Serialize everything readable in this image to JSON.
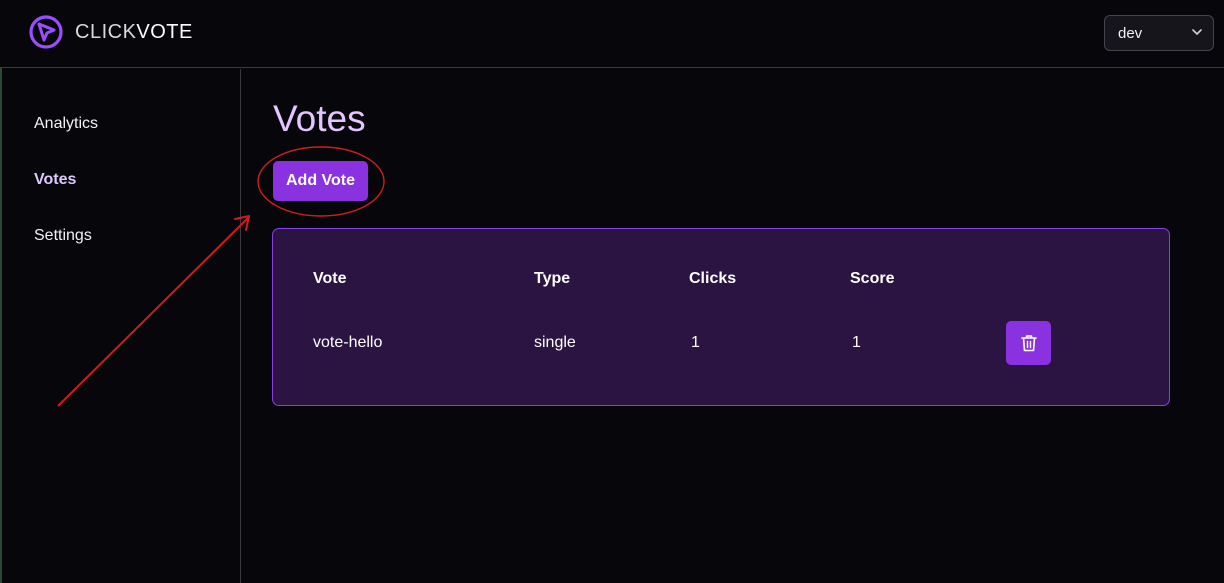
{
  "header": {
    "brand_part1": "CLICK",
    "brand_part2": "VOTE",
    "environment": {
      "selected": "dev",
      "icon": "chevron-down-icon"
    },
    "logo_icon": "cursor-circle-logo-icon"
  },
  "sidebar": {
    "items": [
      {
        "label": "Analytics",
        "active": false
      },
      {
        "label": "Votes",
        "active": true
      },
      {
        "label": "Settings",
        "active": false
      }
    ]
  },
  "main": {
    "title": "Votes",
    "add_button_label": "Add Vote",
    "table": {
      "headers": [
        "Vote",
        "Type",
        "Clicks",
        "Score"
      ],
      "rows": [
        {
          "vote": "vote-hello",
          "type": "single",
          "clicks": "1",
          "score": "1",
          "action_icon": "trash-icon"
        }
      ]
    }
  },
  "annotation": {
    "color": "#d01c1c"
  },
  "colors": {
    "accent": "#8a32e0",
    "title": "#e3c6ff",
    "card_bg": "#2c1442",
    "card_border": "#8b3de6",
    "background": "#07060b"
  }
}
